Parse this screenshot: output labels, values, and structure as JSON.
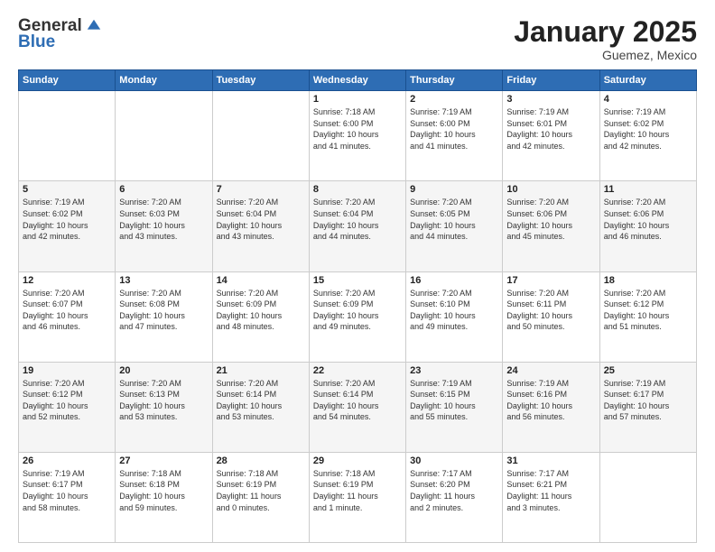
{
  "header": {
    "logo": {
      "general": "General",
      "blue": "Blue"
    },
    "title": "January 2025",
    "subtitle": "Guemez, Mexico"
  },
  "weekdays": [
    "Sunday",
    "Monday",
    "Tuesday",
    "Wednesday",
    "Thursday",
    "Friday",
    "Saturday"
  ],
  "weeks": [
    [
      {
        "day": "",
        "info": ""
      },
      {
        "day": "",
        "info": ""
      },
      {
        "day": "",
        "info": ""
      },
      {
        "day": "1",
        "info": "Sunrise: 7:18 AM\nSunset: 6:00 PM\nDaylight: 10 hours\nand 41 minutes."
      },
      {
        "day": "2",
        "info": "Sunrise: 7:19 AM\nSunset: 6:00 PM\nDaylight: 10 hours\nand 41 minutes."
      },
      {
        "day": "3",
        "info": "Sunrise: 7:19 AM\nSunset: 6:01 PM\nDaylight: 10 hours\nand 42 minutes."
      },
      {
        "day": "4",
        "info": "Sunrise: 7:19 AM\nSunset: 6:02 PM\nDaylight: 10 hours\nand 42 minutes."
      }
    ],
    [
      {
        "day": "5",
        "info": "Sunrise: 7:19 AM\nSunset: 6:02 PM\nDaylight: 10 hours\nand 42 minutes."
      },
      {
        "day": "6",
        "info": "Sunrise: 7:20 AM\nSunset: 6:03 PM\nDaylight: 10 hours\nand 43 minutes."
      },
      {
        "day": "7",
        "info": "Sunrise: 7:20 AM\nSunset: 6:04 PM\nDaylight: 10 hours\nand 43 minutes."
      },
      {
        "day": "8",
        "info": "Sunrise: 7:20 AM\nSunset: 6:04 PM\nDaylight: 10 hours\nand 44 minutes."
      },
      {
        "day": "9",
        "info": "Sunrise: 7:20 AM\nSunset: 6:05 PM\nDaylight: 10 hours\nand 44 minutes."
      },
      {
        "day": "10",
        "info": "Sunrise: 7:20 AM\nSunset: 6:06 PM\nDaylight: 10 hours\nand 45 minutes."
      },
      {
        "day": "11",
        "info": "Sunrise: 7:20 AM\nSunset: 6:06 PM\nDaylight: 10 hours\nand 46 minutes."
      }
    ],
    [
      {
        "day": "12",
        "info": "Sunrise: 7:20 AM\nSunset: 6:07 PM\nDaylight: 10 hours\nand 46 minutes."
      },
      {
        "day": "13",
        "info": "Sunrise: 7:20 AM\nSunset: 6:08 PM\nDaylight: 10 hours\nand 47 minutes."
      },
      {
        "day": "14",
        "info": "Sunrise: 7:20 AM\nSunset: 6:09 PM\nDaylight: 10 hours\nand 48 minutes."
      },
      {
        "day": "15",
        "info": "Sunrise: 7:20 AM\nSunset: 6:09 PM\nDaylight: 10 hours\nand 49 minutes."
      },
      {
        "day": "16",
        "info": "Sunrise: 7:20 AM\nSunset: 6:10 PM\nDaylight: 10 hours\nand 49 minutes."
      },
      {
        "day": "17",
        "info": "Sunrise: 7:20 AM\nSunset: 6:11 PM\nDaylight: 10 hours\nand 50 minutes."
      },
      {
        "day": "18",
        "info": "Sunrise: 7:20 AM\nSunset: 6:12 PM\nDaylight: 10 hours\nand 51 minutes."
      }
    ],
    [
      {
        "day": "19",
        "info": "Sunrise: 7:20 AM\nSunset: 6:12 PM\nDaylight: 10 hours\nand 52 minutes."
      },
      {
        "day": "20",
        "info": "Sunrise: 7:20 AM\nSunset: 6:13 PM\nDaylight: 10 hours\nand 53 minutes."
      },
      {
        "day": "21",
        "info": "Sunrise: 7:20 AM\nSunset: 6:14 PM\nDaylight: 10 hours\nand 53 minutes."
      },
      {
        "day": "22",
        "info": "Sunrise: 7:20 AM\nSunset: 6:14 PM\nDaylight: 10 hours\nand 54 minutes."
      },
      {
        "day": "23",
        "info": "Sunrise: 7:19 AM\nSunset: 6:15 PM\nDaylight: 10 hours\nand 55 minutes."
      },
      {
        "day": "24",
        "info": "Sunrise: 7:19 AM\nSunset: 6:16 PM\nDaylight: 10 hours\nand 56 minutes."
      },
      {
        "day": "25",
        "info": "Sunrise: 7:19 AM\nSunset: 6:17 PM\nDaylight: 10 hours\nand 57 minutes."
      }
    ],
    [
      {
        "day": "26",
        "info": "Sunrise: 7:19 AM\nSunset: 6:17 PM\nDaylight: 10 hours\nand 58 minutes."
      },
      {
        "day": "27",
        "info": "Sunrise: 7:18 AM\nSunset: 6:18 PM\nDaylight: 10 hours\nand 59 minutes."
      },
      {
        "day": "28",
        "info": "Sunrise: 7:18 AM\nSunset: 6:19 PM\nDaylight: 11 hours\nand 0 minutes."
      },
      {
        "day": "29",
        "info": "Sunrise: 7:18 AM\nSunset: 6:19 PM\nDaylight: 11 hours\nand 1 minute."
      },
      {
        "day": "30",
        "info": "Sunrise: 7:17 AM\nSunset: 6:20 PM\nDaylight: 11 hours\nand 2 minutes."
      },
      {
        "day": "31",
        "info": "Sunrise: 7:17 AM\nSunset: 6:21 PM\nDaylight: 11 hours\nand 3 minutes."
      },
      {
        "day": "",
        "info": ""
      }
    ]
  ]
}
